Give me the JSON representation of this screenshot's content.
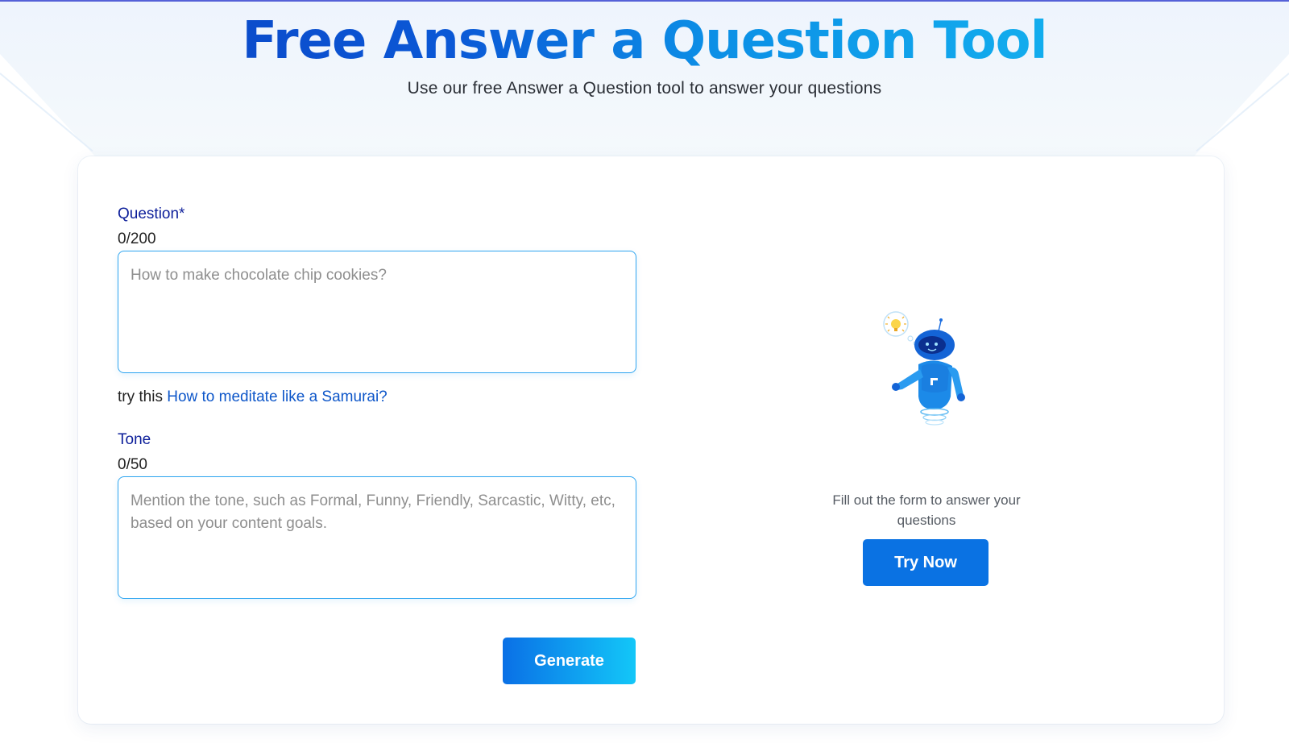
{
  "header": {
    "title": "Free Answer a Question Tool",
    "subtitle": "Use our free Answer a Question tool to answer your questions"
  },
  "form": {
    "question": {
      "label": "Question*",
      "counter": "0/200",
      "value": "",
      "placeholder": "How to make chocolate chip cookies?"
    },
    "suggestion": {
      "prefix": "try this",
      "link_text": "How to meditate like a Samurai?"
    },
    "tone": {
      "label": "Tone",
      "counter": "0/50",
      "value": "",
      "placeholder": "Mention the tone, such as Formal, Funny, Friendly, Sarcastic, Witty, etc, based on your content goals."
    },
    "generate_label": "Generate"
  },
  "side_panel": {
    "illustration": "robot-thinking-lightbulb-icon",
    "message": "Fill out the form to answer your questions",
    "cta_label": "Try Now"
  },
  "colors": {
    "accent": "#0a72e3",
    "label_blue": "#0d1f9a",
    "link_blue": "#0d56c9",
    "input_border": "#2fa5f0",
    "title_gradient_start": "#0b3fc0",
    "title_gradient_end": "#17c3f3"
  }
}
